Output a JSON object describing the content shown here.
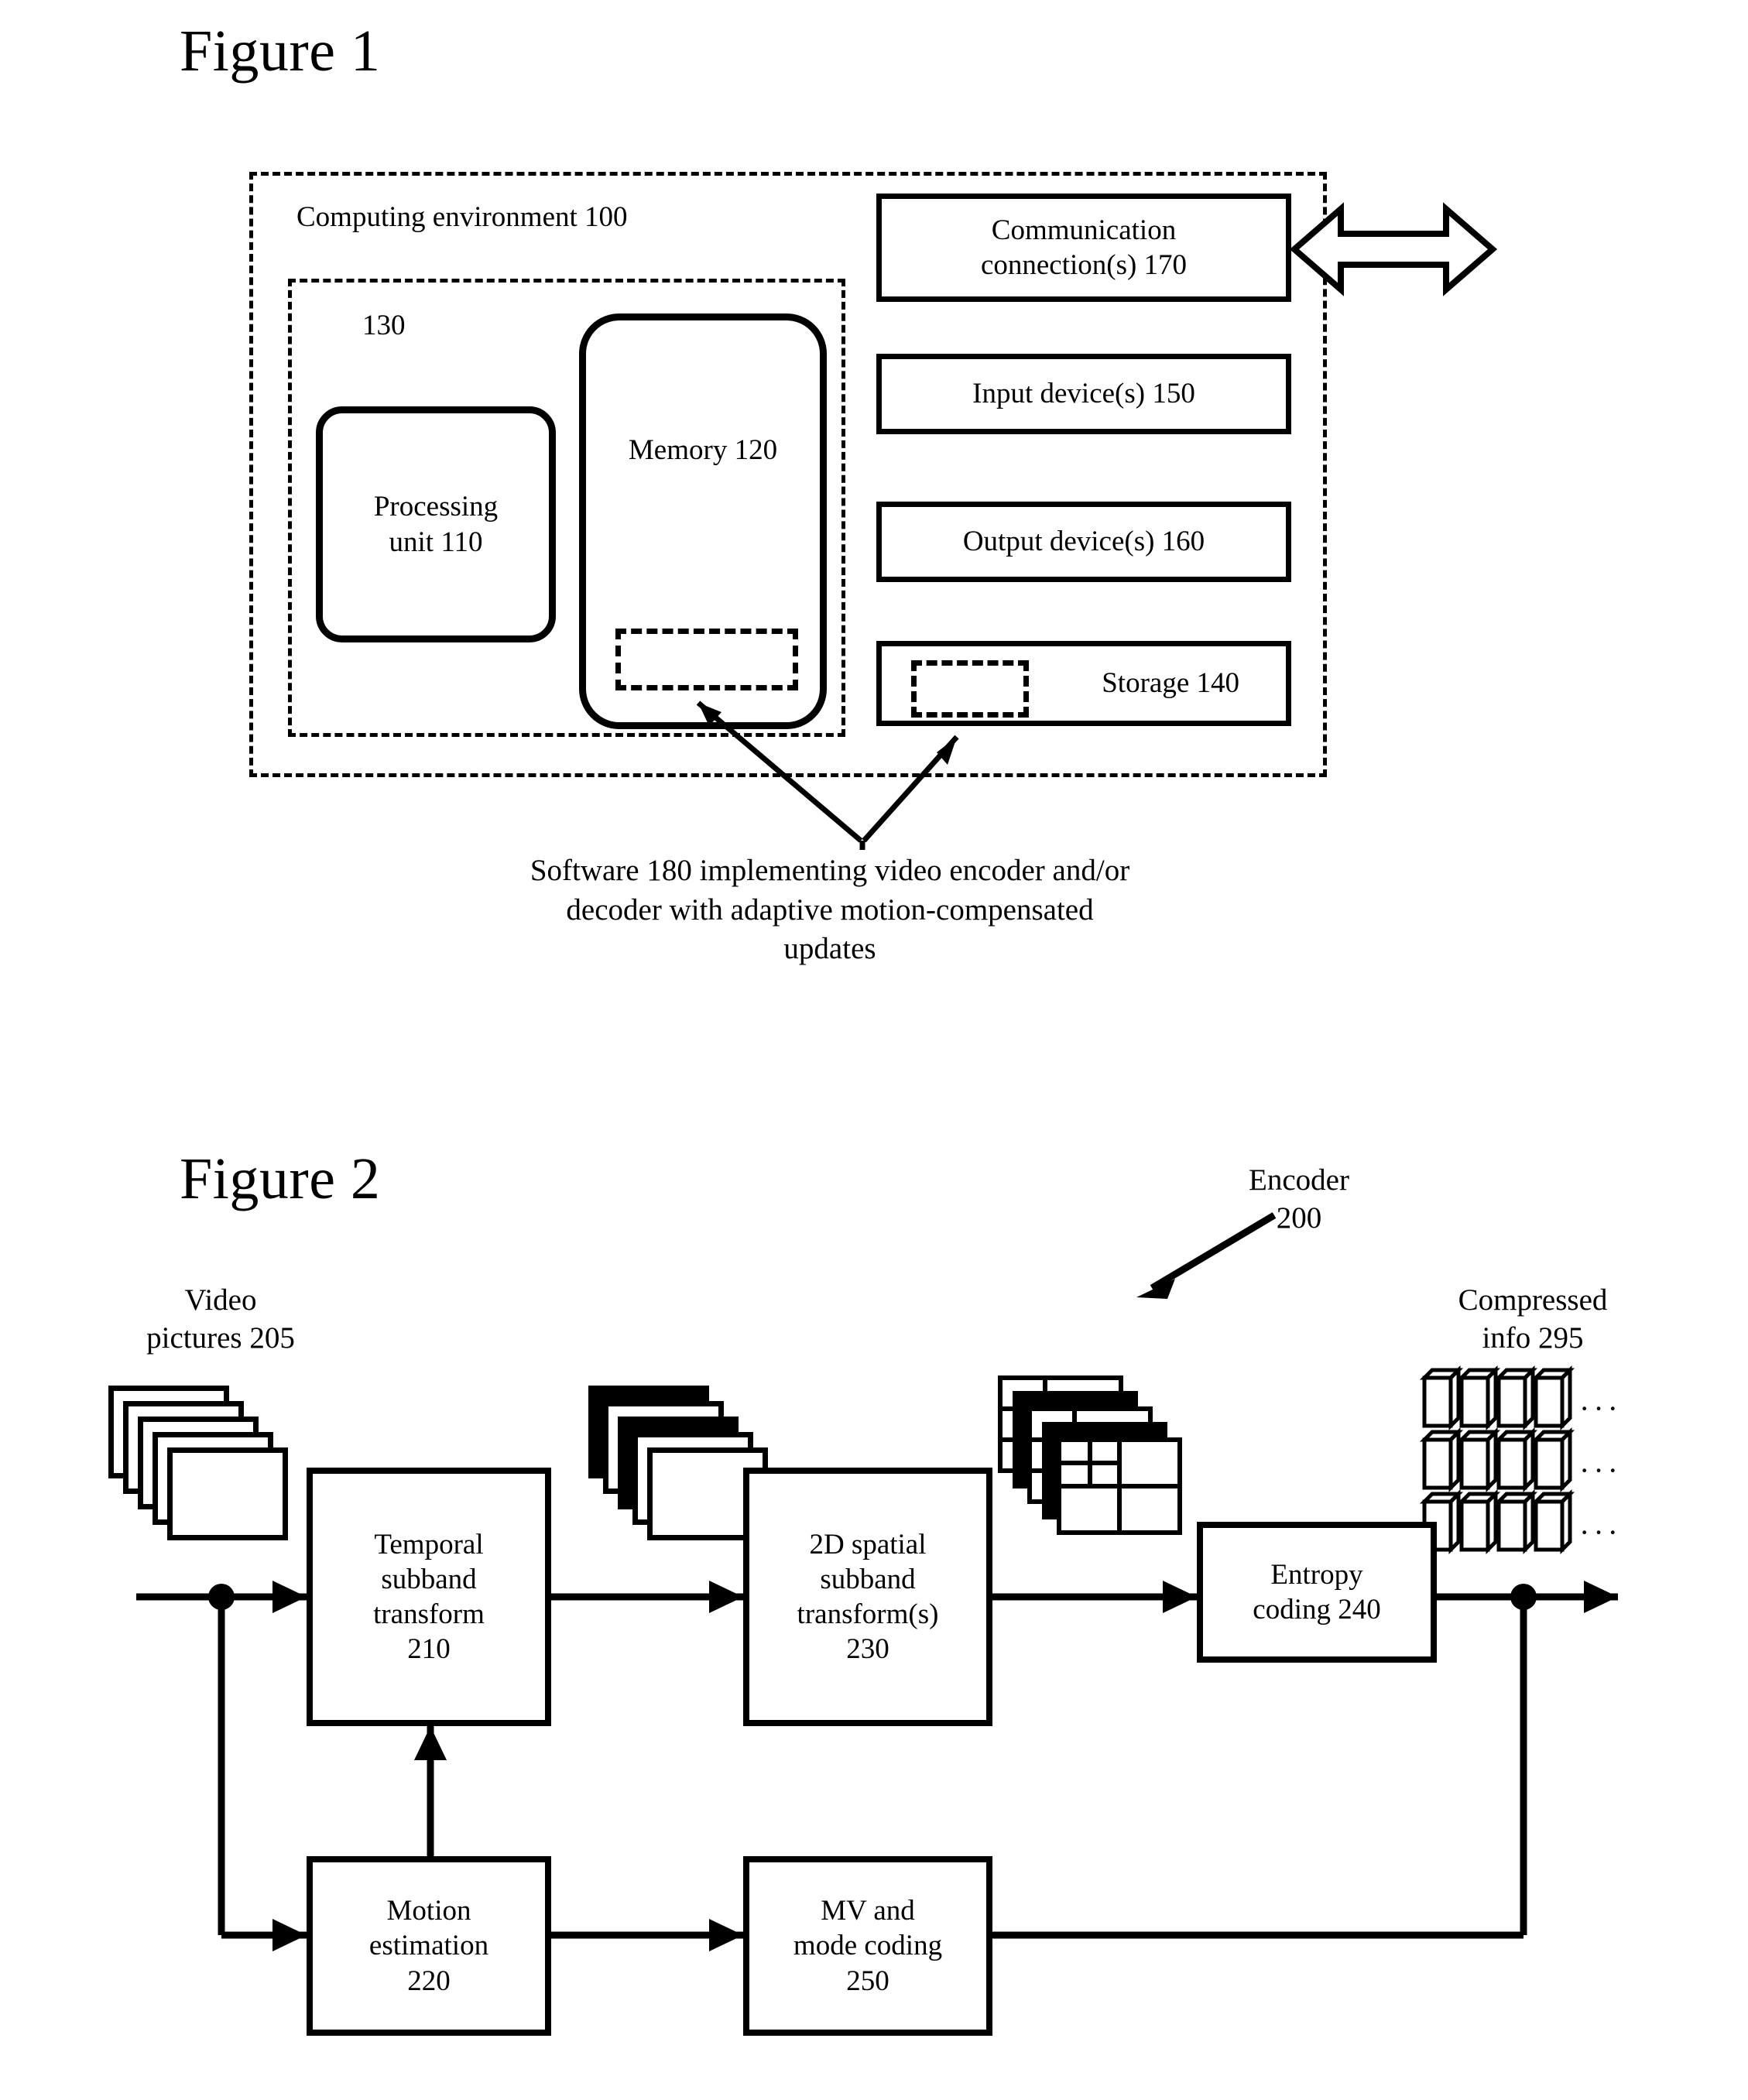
{
  "figure1": {
    "title": "Figure 1",
    "environment_label": "Computing environment 100",
    "group_label": "130",
    "processing_unit": "Processing unit 110",
    "memory": "Memory 120",
    "communication": "Communication connection(s) 170",
    "input_device": "Input device(s) 150",
    "output_device": "Output device(s) 160",
    "storage": "Storage 140",
    "software_caption": "Software 180 implementing video encoder and/or decoder with adaptive motion-compensated updates",
    "software_caption_lines": [
      "Software 180 implementing video encoder and/or",
      "decoder with adaptive motion-compensated",
      "updates"
    ]
  },
  "figure2": {
    "title": "Figure 2",
    "encoder_label_lines": [
      "Encoder",
      "200"
    ],
    "input_label_lines": [
      "Video",
      "pictures 205"
    ],
    "output_label_lines": [
      "Compressed",
      "info 295"
    ],
    "ellipsis": "···",
    "boxes": [
      {
        "id": "temporal-subband-transform",
        "lines": [
          "Temporal",
          "subband",
          "transform",
          "210"
        ]
      },
      {
        "id": "spatial-subband-transform",
        "lines": [
          "2D spatial",
          "subband",
          "transform(s)",
          "230"
        ]
      },
      {
        "id": "entropy-coding",
        "lines": [
          "Entropy",
          "coding 240"
        ]
      },
      {
        "id": "motion-estimation",
        "lines": [
          "Motion",
          "estimation",
          "220"
        ]
      },
      {
        "id": "mv-mode-coding",
        "lines": [
          "MV and",
          "mode coding",
          "250"
        ]
      }
    ]
  },
  "colors": {
    "ink": "#000000",
    "paper": "#ffffff"
  }
}
